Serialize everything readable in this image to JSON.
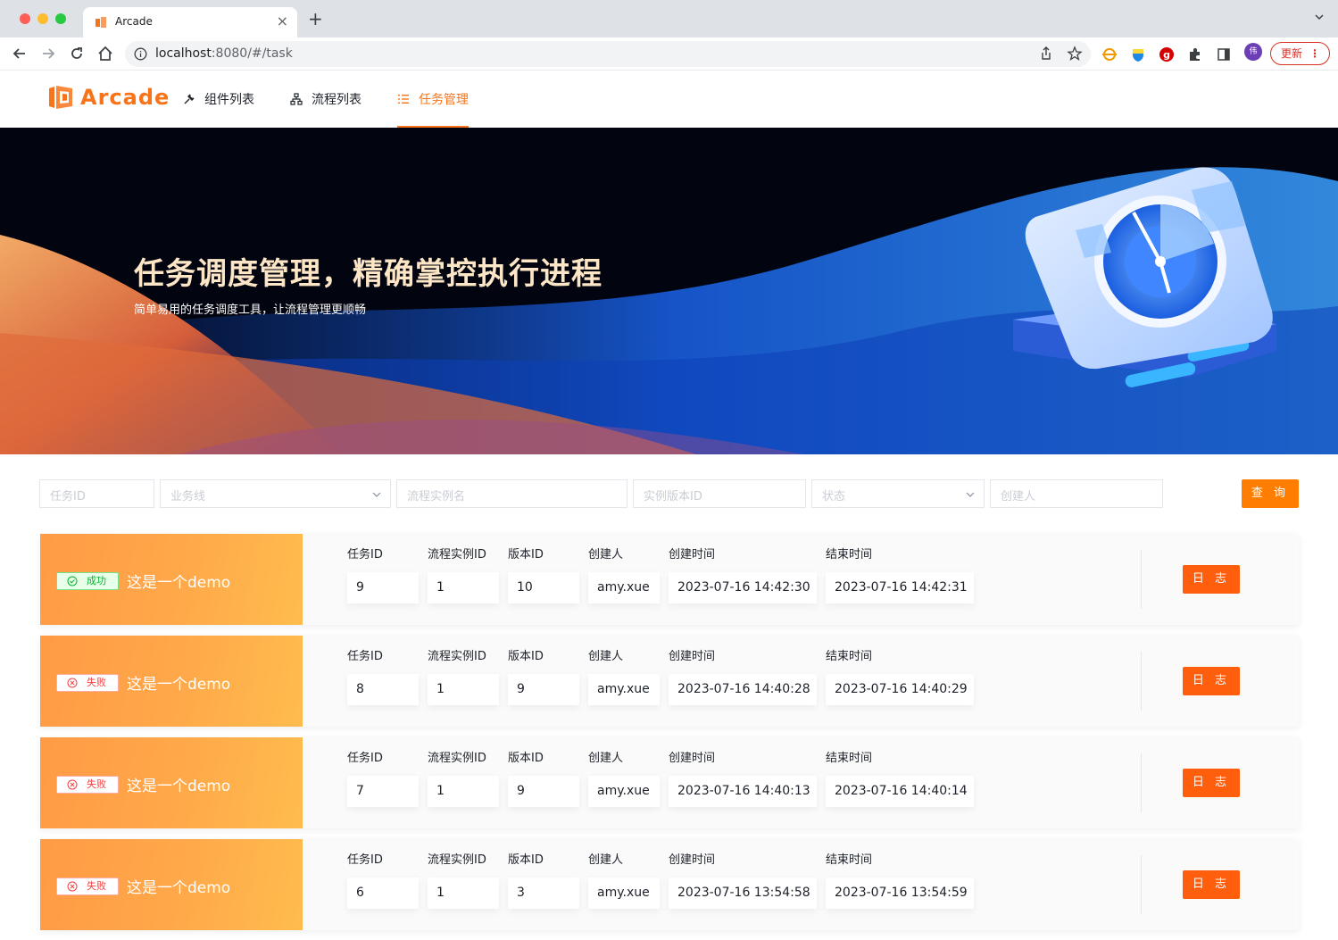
{
  "browser": {
    "tab_title": "Arcade",
    "url_host": "localhost",
    "url_rest": ":8080/#/task",
    "avatar_text": "伟",
    "update_label": "更新"
  },
  "header": {
    "logo_text": "Arcade",
    "nav": [
      {
        "label": "组件列表",
        "icon": "wrench-icon"
      },
      {
        "label": "流程列表",
        "icon": "flow-icon"
      },
      {
        "label": "任务管理",
        "icon": "list-icon",
        "active": true
      }
    ]
  },
  "banner": {
    "title": "任务调度管理，精确掌控执行进程",
    "subtitle": "简单易用的任务调度工具，让流程管理更顺畅"
  },
  "filters": {
    "task_id_placeholder": "任务ID",
    "business_line_placeholder": "业务线",
    "flow_instance_placeholder": "流程实例名",
    "instance_version_placeholder": "实例版本ID",
    "status_placeholder": "状态",
    "creator_placeholder": "创建人",
    "query_label": "查 询"
  },
  "columns": {
    "task_id": "任务ID",
    "flow_instance_id": "流程实例ID",
    "version_id": "版本ID",
    "creator": "创建人",
    "created_at": "创建时间",
    "ended_at": "结束时间"
  },
  "log_label": "日 志",
  "tasks": [
    {
      "status": "成功",
      "status_type": "success",
      "name": "这是一个demo",
      "task_id": "9",
      "flow_instance_id": "1",
      "version_id": "10",
      "creator": "amy.xue",
      "created_at": "2023-07-16 14:42:30",
      "ended_at": "2023-07-16 14:42:31"
    },
    {
      "status": "失败",
      "status_type": "fail",
      "name": "这是一个demo",
      "task_id": "8",
      "flow_instance_id": "1",
      "version_id": "9",
      "creator": "amy.xue",
      "created_at": "2023-07-16 14:40:28",
      "ended_at": "2023-07-16 14:40:29"
    },
    {
      "status": "失败",
      "status_type": "fail",
      "name": "这是一个demo",
      "task_id": "7",
      "flow_instance_id": "1",
      "version_id": "9",
      "creator": "amy.xue",
      "created_at": "2023-07-16 14:40:13",
      "ended_at": "2023-07-16 14:40:14"
    },
    {
      "status": "失败",
      "status_type": "fail",
      "name": "这是一个demo",
      "task_id": "6",
      "flow_instance_id": "1",
      "version_id": "3",
      "creator": "amy.xue",
      "created_at": "2023-07-16 13:54:58",
      "ended_at": "2023-07-16 13:54:59"
    }
  ],
  "colors": {
    "accent": "#f7741a",
    "button": "#ff5e0c",
    "success": "#00b42a",
    "fail": "#f53f3f"
  }
}
